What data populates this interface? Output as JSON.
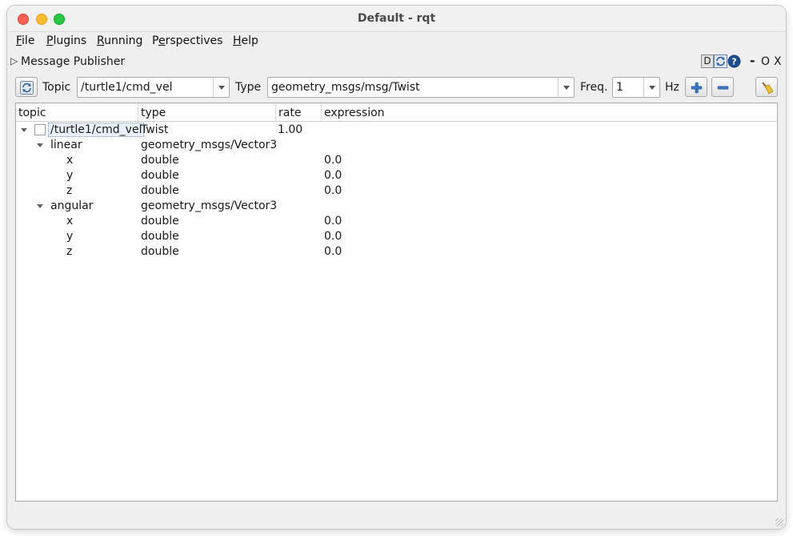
{
  "window": {
    "title": "Default - rqt"
  },
  "menu": [
    {
      "u": "F",
      "rest": "ile"
    },
    {
      "u": "P",
      "rest": "lugins"
    },
    {
      "u": "R",
      "rest": "unning"
    },
    {
      "pre": "P",
      "u": "e",
      "rest": "rspectives"
    },
    {
      "u": "H",
      "rest": "elp"
    }
  ],
  "plugin": {
    "title": "Message Publisher",
    "dock_d": "D",
    "dock_min": "-",
    "dock_o": "O",
    "dock_x": "X",
    "icons": [
      "reload-icon",
      "help-icon"
    ]
  },
  "toolbar": {
    "topic_label": "Topic",
    "topic_value": "/turtle1/cmd_vel",
    "type_label": "Type",
    "type_value": "geometry_msgs/msg/Twist",
    "freq_label": "Freq.",
    "freq_value": "1",
    "hz_label": "Hz",
    "icons": [
      "refresh-icon",
      "plus-icon",
      "minus-icon",
      "broom-icon"
    ]
  },
  "tree": {
    "headers": [
      "topic",
      "type",
      "rate",
      "expression"
    ],
    "rows": [
      {
        "topic": "/turtle1/cmd_vel",
        "type": "Twist",
        "rate": "1.00",
        "expression": ""
      },
      {
        "topic": "linear",
        "type": "geometry_msgs/Vector3",
        "rate": "",
        "expression": ""
      },
      {
        "topic": "x",
        "type": "double",
        "rate": "",
        "expression": "0.0"
      },
      {
        "topic": "y",
        "type": "double",
        "rate": "",
        "expression": "0.0"
      },
      {
        "topic": "z",
        "type": "double",
        "rate": "",
        "expression": "0.0"
      },
      {
        "topic": "angular",
        "type": "geometry_msgs/Vector3",
        "rate": "",
        "expression": ""
      },
      {
        "topic": "x",
        "type": "double",
        "rate": "",
        "expression": "0.0"
      },
      {
        "topic": "y",
        "type": "double",
        "rate": "",
        "expression": "0.0"
      },
      {
        "topic": "z",
        "type": "double",
        "rate": "",
        "expression": "0.0"
      }
    ]
  },
  "colors": {
    "accent": "#2f6fbf",
    "close": "#fe5f57",
    "minimize": "#febc2e",
    "maximize": "#28c840"
  }
}
